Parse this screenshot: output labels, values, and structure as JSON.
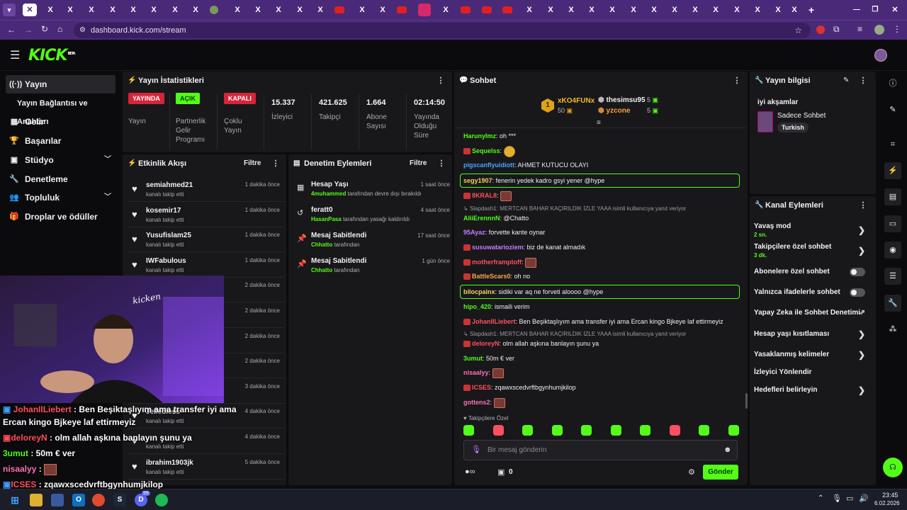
{
  "browser": {
    "url": "dashboard.kick.com/stream",
    "tab_glyph": "X"
  },
  "brand": {
    "logo": "KICK",
    "beta": "BETA",
    "accent": "#53fc18"
  },
  "nav": {
    "items": [
      {
        "label": "Yayın",
        "icon": "broadcast-icon"
      },
      {
        "label": "Yayın Bağlantısı ve Anahtarı",
        "icon": ""
      },
      {
        "label": "Gelir",
        "icon": "revenue-icon"
      },
      {
        "label": "Başarılar",
        "icon": "trophy-icon"
      },
      {
        "label": "Stüdyo",
        "icon": "studio-icon"
      },
      {
        "label": "Denetleme",
        "icon": "moderation-icon"
      },
      {
        "label": "Topluluk",
        "icon": "community-icon"
      },
      {
        "label": "Droplar ve ödüller",
        "icon": "drops-icon"
      }
    ]
  },
  "stats": {
    "title": "Yayın İstatistikleri",
    "live_badge": "YAYINDA",
    "live_label": "Yayın",
    "partner_badge": "AÇIK",
    "partner_label": "Partnerlik Gelir Programı",
    "multi_badge": "KAPALI",
    "multi_label": "Çoklu Yayın",
    "viewers": "15.337",
    "viewers_label": "İzleyici",
    "followers": "421.625",
    "followers_label": "Takipçi",
    "subs": "1.664",
    "subs_label": "Abone Sayısı",
    "uptime": "02:14:50",
    "uptime_label": "Yayında Olduğu Süre"
  },
  "activity": {
    "title": "Etkinlik Akışı",
    "filter": "Filtre",
    "rows": [
      {
        "name": "semiahmed21",
        "sub": "kanalı takip etti",
        "time": "1 dakika önce"
      },
      {
        "name": "kosemir17",
        "sub": "kanalı takip etti",
        "time": "1 dakika önce"
      },
      {
        "name": "Yusufislam25",
        "sub": "kanalı takip etti",
        "time": "1 dakika önce"
      },
      {
        "name": "IWFabulous",
        "sub": "kanalı takip etti",
        "time": "1 dakika önce"
      },
      {
        "name": "",
        "sub": "",
        "time": "2 dakika önce"
      },
      {
        "name": "",
        "sub": "",
        "time": "2 dakika önce"
      },
      {
        "name": "",
        "sub": "",
        "time": "2 dakika önce"
      },
      {
        "name": "",
        "sub": "",
        "time": "2 dakika önce"
      },
      {
        "name": "",
        "sub": "",
        "time": "3 dakika önce"
      },
      {
        "name": "Jelledless",
        "sub": "kanalı takip etti",
        "time": "4 dakika önce"
      },
      {
        "name": "",
        "sub": "kanalı takip etti",
        "time": "4 dakika önce"
      },
      {
        "name": "ibrahim1903jk",
        "sub": "kanalı takip etti",
        "time": "5 dakika önce"
      }
    ]
  },
  "moderation": {
    "title": "Denetim Eylemleri",
    "filter": "Filtre",
    "rows": [
      {
        "title": "Hesap Yaşı",
        "user": "4muhammed",
        "text": "tarafından devre dışı bırakıldı",
        "time": "1 saat önce",
        "icon": "calendar-icon"
      },
      {
        "title": "feratt0",
        "user": "HasanPasa",
        "text": "tarafından yasağı kaldırıldı",
        "time": "4 saat önce",
        "icon": "undo-icon"
      },
      {
        "title": "Mesaj Sabitlendi",
        "user": "Chhatto",
        "text": "tarafından",
        "time": "17 saat önce",
        "icon": "pin-icon"
      },
      {
        "title": "Mesaj Sabitlendi",
        "user": "Chhatto",
        "text": "tarafından",
        "time": "1 gün önce",
        "icon": "pin-icon"
      }
    ]
  },
  "chat": {
    "title": "Sohbet",
    "top_gifter": {
      "name": "xKO4FUNx",
      "amount": "50"
    },
    "gifter2": {
      "name": "thesimsu95",
      "amount": "5"
    },
    "gifter3": {
      "name": "yzcone",
      "amount": "5"
    },
    "messages": [
      {
        "user": "HarunyImz",
        "color": "#53fc18",
        "text": "oh ***"
      },
      {
        "user": "Sequelss",
        "color": "#53fc18",
        "text": ""
      },
      {
        "user": "pigscanflyuidiott",
        "color": "#4aa3ff",
        "text": "AHMET KUTUCU OLAYI"
      },
      {
        "user": "segy1907",
        "color": "#f2d45c",
        "text": "fenerin yedek kadro gsyi yener @hype"
      },
      {
        "user": "8KRAL8",
        "color": "#ff4f5e",
        "text": ""
      },
      {
        "reply": "Slapdash1: MERTCAN BAHAR KAÇIRILDIK İZLE YAAA isimli kullanıcıya yanıt veriyor"
      },
      {
        "user": "AliiErennnN",
        "color": "#53fc18",
        "text": "@Chatto"
      },
      {
        "user": "95Ayaz",
        "color": "#c77dff",
        "text": "forvette kante oynar"
      },
      {
        "user": "susuwatarioziem",
        "color": "#c77dff",
        "text": "biz de kanat almadık"
      },
      {
        "user": "motherframptoff",
        "color": "#ff4f5e",
        "text": ""
      },
      {
        "user": "BattleScars0",
        "color": "#ffa54f",
        "text": "oh no"
      },
      {
        "user": "bilocpainx",
        "color": "#f2d45c",
        "text": "sidiki var aq ne forveti aloooo @hype"
      },
      {
        "user": "hipo_420",
        "color": "#53fc18",
        "text": "ismaili verim"
      },
      {
        "user": "JohanIILiebert",
        "color": "#ff4f5e",
        "text": "Ben Beşiktaşlıyım ama transfer iyi ama Ercan kingo Bjkeye laf ettirmeyiz"
      },
      {
        "reply": "Slapdash1: MERTCAN BAHAR KAÇIRILDIK İZLE YAAA isimli kullanıcıya yanıt veriyor"
      },
      {
        "user": "deloreyN",
        "color": "#ff4f5e",
        "text": "olm allah aşkına banlayın şunu ya"
      },
      {
        "user": "3umut",
        "color": "#53fc18",
        "text": "50m € ver"
      },
      {
        "user": "nisaalyy",
        "color": "#ff6fb5",
        "text": ""
      },
      {
        "user": "ICSES",
        "color": "#ff4f5e",
        "text": "zqawxscedvrftbgynhumjkilop"
      },
      {
        "user": "gottens2",
        "color": "#ff6fb5",
        "text": ""
      }
    ],
    "followers_only": "Takipçilere Özel",
    "input_placeholder": "Bir mesaj gönderin",
    "count": "0",
    "send": "Gönder"
  },
  "info": {
    "title": "Yayın bilgisi",
    "stream_title": "iyi akşamlar",
    "category": "Sadece Sohbet",
    "language": "Turkish"
  },
  "channel": {
    "title": "Kanal Eylemleri",
    "slow_mode": "Yavaş mod",
    "slow_val": "2 sn.",
    "followers_chat": "Takipçilere özel sohbet",
    "followers_val": "3 dk.",
    "subs_chat": "Abonelere özel sohbet",
    "emote_chat": "Yalnızca ifadelerle sohbet",
    "ai_mod": "Yapay Zeka ile Sohbet Denetimi",
    "age": "Hesap yaşı kısıtlaması",
    "banned_words": "Yasaklanmış kelimeler",
    "redirect": "İzleyici Yönlendir",
    "goals": "Hedefleri belirleyin"
  },
  "overlay": {
    "lines": [
      {
        "user": "JohanIILiebert",
        "text": "Ben Beşiktaşlıyım ama transfer iyi ama"
      },
      {
        "user": "",
        "text": "Ercan kingo Bjkeye laf ettirmeyiz"
      },
      {
        "user": "deloreyN",
        "text": "olm allah aşkına banlayın şunu ya"
      },
      {
        "user": "3umut",
        "text": "50m € ver"
      },
      {
        "user": "nisaalyy",
        "text": ""
      },
      {
        "user": "ICSES",
        "text": "zqawxscedvrftbgynhumjkilop"
      }
    ]
  },
  "taskbar": {
    "time": "23:45",
    "date": "6.02.2026",
    "badge": "99"
  }
}
